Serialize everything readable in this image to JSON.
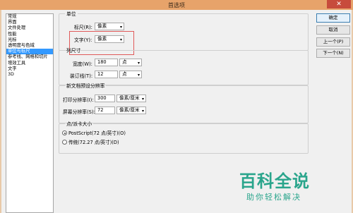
{
  "window": {
    "title": "首选项",
    "close_label": "✕"
  },
  "sidebar": {
    "items": [
      {
        "label": "常规"
      },
      {
        "label": "界面"
      },
      {
        "label": "文件处理"
      },
      {
        "label": "性能"
      },
      {
        "label": "光标"
      },
      {
        "label": "透明度与色域"
      },
      {
        "label": "单位与标尺",
        "selected": true
      },
      {
        "label": "参考线、网格和切片"
      },
      {
        "label": "增效工具"
      },
      {
        "label": "文字"
      },
      {
        "label": "3D"
      }
    ]
  },
  "units": {
    "legend": "单位",
    "ruler_label": "标尺(R):",
    "ruler_value": "像素",
    "type_label": "文字(Y):",
    "type_value": "像素"
  },
  "column_size": {
    "legend": "列尺寸",
    "width_label": "宽度(W):",
    "width_value": "180",
    "width_unit": "点",
    "gutter_label": "装订线(T):",
    "gutter_value": "12",
    "gutter_unit": "点"
  },
  "new_doc_resolution": {
    "legend": "新文档预设分辨率",
    "print_label": "打印分辨率(I):",
    "print_value": "300",
    "print_unit": "像素/厘米",
    "screen_label": "屏幕分辨率(S):",
    "screen_value": "72",
    "screen_unit": "像素/厘米"
  },
  "point_size": {
    "legend": "点/派卡大小",
    "option_postscript": "PostScript(72 点/英寸)(O)",
    "option_traditional": "传统(72.27 点/英寸)(D)",
    "selected": "postscript"
  },
  "buttons": {
    "ok": "确定",
    "cancel": "取消",
    "prev": "上一个(P)",
    "next": "下一个(N)"
  },
  "watermark": {
    "text": "百科全说",
    "subtext": "助你轻松解决"
  },
  "colors": {
    "selection": "#3399ff",
    "highlight_box": "#e05a5a",
    "watermark": "#2aa58c"
  }
}
